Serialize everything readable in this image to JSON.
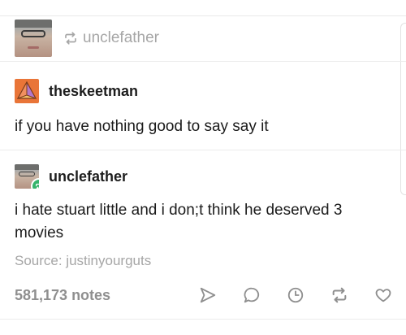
{
  "header": {
    "reblogger": "unclefather",
    "reblog_icon": "reblog-icon"
  },
  "post": {
    "original": {
      "username": "theskeetman",
      "avatar_icon": "pyramid-avatar",
      "text": "if you have nothing good to say say it"
    },
    "reblog": {
      "username": "unclefather",
      "badge_icon": "reblog-badge-icon",
      "text": "i hate stuart little and i don;t think he deserved 3 movies"
    },
    "source": "Source: justinyourguts"
  },
  "footer": {
    "notes": "581,173 notes",
    "actions": [
      "share-icon",
      "reply-icon",
      "history-icon",
      "reblog-icon",
      "like-icon"
    ]
  },
  "colors": {
    "badge_green": "#35b46b",
    "avatar_orange": "#e97538",
    "muted_text": "#a6a6a6"
  }
}
